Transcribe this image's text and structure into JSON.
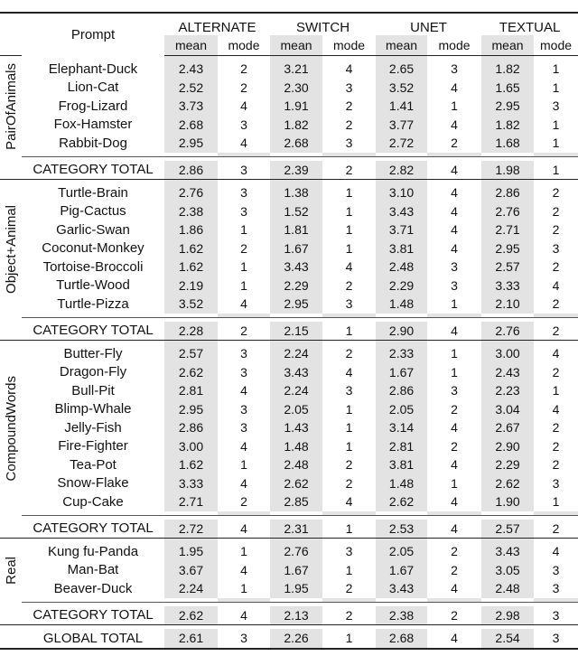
{
  "header": {
    "prompt": "Prompt",
    "methods": [
      "ALTERNATE",
      "SWITCH",
      "UNET",
      "TEXTUAL"
    ],
    "mean": "mean",
    "mode": "mode"
  },
  "shade_color": "#e3e3e3",
  "groups": [
    {
      "label": "PairOfAnimals",
      "rows": [
        {
          "prompt": "Elephant-Duck",
          "values": [
            "2.43",
            "2",
            "3.21",
            "4",
            "2.65",
            "3",
            "1.82",
            "1"
          ]
        },
        {
          "prompt": "Lion-Cat",
          "values": [
            "2.52",
            "2",
            "2.30",
            "3",
            "3.52",
            "4",
            "1.65",
            "1"
          ]
        },
        {
          "prompt": "Frog-Lizard",
          "values": [
            "3.73",
            "4",
            "1.91",
            "2",
            "1.41",
            "1",
            "2.95",
            "3"
          ]
        },
        {
          "prompt": "Fox-Hamster",
          "values": [
            "2.68",
            "3",
            "1.82",
            "2",
            "3.77",
            "4",
            "1.82",
            "1"
          ]
        },
        {
          "prompt": "Rabbit-Dog",
          "values": [
            "2.95",
            "4",
            "2.68",
            "3",
            "2.72",
            "2",
            "1.68",
            "1"
          ]
        }
      ],
      "total": {
        "prompt": "CATEGORY TOTAL",
        "values": [
          "2.86",
          "3",
          "2.39",
          "2",
          "2.82",
          "4",
          "1.98",
          "1"
        ]
      }
    },
    {
      "label": "Object+Animal",
      "rows": [
        {
          "prompt": "Turtle-Brain",
          "values": [
            "2.76",
            "3",
            "1.38",
            "1",
            "3.10",
            "4",
            "2.86",
            "2"
          ]
        },
        {
          "prompt": "Pig-Cactus",
          "values": [
            "2.38",
            "3",
            "1.52",
            "1",
            "3.43",
            "4",
            "2.76",
            "2"
          ]
        },
        {
          "prompt": "Garlic-Swan",
          "values": [
            "1.86",
            "1",
            "1.81",
            "1",
            "3.71",
            "4",
            "2.71",
            "2"
          ]
        },
        {
          "prompt": "Coconut-Monkey",
          "values": [
            "1.62",
            "2",
            "1.67",
            "1",
            "3.81",
            "4",
            "2.95",
            "3"
          ]
        },
        {
          "prompt": "Tortoise-Broccoli",
          "values": [
            "1.62",
            "1",
            "3.43",
            "4",
            "2.48",
            "3",
            "2.57",
            "2"
          ]
        },
        {
          "prompt": "Turtle-Wood",
          "values": [
            "2.19",
            "1",
            "2.29",
            "2",
            "2.29",
            "3",
            "3.33",
            "4"
          ]
        },
        {
          "prompt": "Turtle-Pizza",
          "values": [
            "3.52",
            "4",
            "2.95",
            "3",
            "1.48",
            "1",
            "2.10",
            "2"
          ]
        }
      ],
      "total": {
        "prompt": "CATEGORY TOTAL",
        "values": [
          "2.28",
          "2",
          "2.15",
          "1",
          "2.90",
          "4",
          "2.76",
          "2"
        ]
      }
    },
    {
      "label": "CompoundWords",
      "rows": [
        {
          "prompt": "Butter-Fly",
          "values": [
            "2.57",
            "3",
            "2.24",
            "2",
            "2.33",
            "1",
            "3.00",
            "4"
          ]
        },
        {
          "prompt": "Dragon-Fly",
          "values": [
            "2.62",
            "3",
            "3.43",
            "4",
            "1.67",
            "1",
            "2.43",
            "2"
          ]
        },
        {
          "prompt": "Bull-Pit",
          "values": [
            "2.81",
            "4",
            "2.24",
            "3",
            "2.86",
            "3",
            "2.23",
            "1"
          ]
        },
        {
          "prompt": "Blimp-Whale",
          "values": [
            "2.95",
            "3",
            "2.05",
            "1",
            "2.05",
            "2",
            "3.04",
            "4"
          ]
        },
        {
          "prompt": "Jelly-Fish",
          "values": [
            "2.86",
            "3",
            "1.43",
            "1",
            "3.14",
            "4",
            "2.67",
            "2"
          ]
        },
        {
          "prompt": "Fire-Fighter",
          "values": [
            "3.00",
            "4",
            "1.48",
            "1",
            "2.81",
            "2",
            "2.90",
            "2"
          ]
        },
        {
          "prompt": "Tea-Pot",
          "values": [
            "1.62",
            "1",
            "2.48",
            "2",
            "3.81",
            "4",
            "2.29",
            "2"
          ]
        },
        {
          "prompt": "Snow-Flake",
          "values": [
            "3.33",
            "4",
            "2.62",
            "2",
            "1.48",
            "1",
            "2.62",
            "3"
          ]
        },
        {
          "prompt": "Cup-Cake",
          "values": [
            "2.71",
            "2",
            "2.85",
            "4",
            "2.62",
            "4",
            "1.90",
            "1"
          ]
        }
      ],
      "total": {
        "prompt": "CATEGORY TOTAL",
        "values": [
          "2.72",
          "4",
          "2.31",
          "1",
          "2.53",
          "4",
          "2.57",
          "2"
        ]
      }
    },
    {
      "label": "Real",
      "rows": [
        {
          "prompt": "Kung fu-Panda",
          "values": [
            "1.95",
            "1",
            "2.76",
            "3",
            "2.05",
            "2",
            "3.43",
            "4"
          ]
        },
        {
          "prompt": "Man-Bat",
          "values": [
            "3.67",
            "4",
            "1.67",
            "1",
            "1.67",
            "2",
            "3.05",
            "3"
          ]
        },
        {
          "prompt": "Beaver-Duck",
          "values": [
            "2.24",
            "1",
            "1.95",
            "2",
            "3.43",
            "4",
            "2.48",
            "3"
          ]
        }
      ],
      "total": {
        "prompt": "CATEGORY TOTAL",
        "values": [
          "2.62",
          "4",
          "2.13",
          "2",
          "2.38",
          "2",
          "2.98",
          "3"
        ]
      }
    }
  ],
  "global_total": {
    "prompt": "GLOBAL TOTAL",
    "values": [
      "2.61",
      "3",
      "2.26",
      "1",
      "2.68",
      "4",
      "2.54",
      "3"
    ]
  }
}
